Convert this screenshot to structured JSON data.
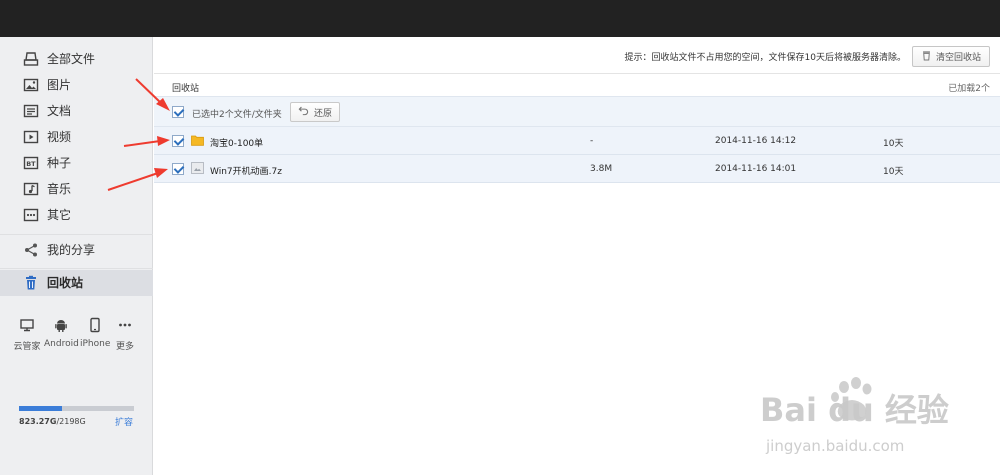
{
  "sidebar": {
    "items": [
      {
        "label": "全部文件",
        "icon": "all-files-icon"
      },
      {
        "label": "图片",
        "icon": "image-icon"
      },
      {
        "label": "文档",
        "icon": "document-icon"
      },
      {
        "label": "视频",
        "icon": "video-icon"
      },
      {
        "label": "种子",
        "icon": "torrent-icon"
      },
      {
        "label": "音乐",
        "icon": "music-icon"
      },
      {
        "label": "其它",
        "icon": "more-icon"
      }
    ],
    "share": {
      "label": "我的分享",
      "icon": "share-icon"
    },
    "recycle": {
      "label": "回收站",
      "icon": "trash-icon"
    },
    "devices": [
      {
        "label": "云管家",
        "icon": "monitor-icon"
      },
      {
        "label": "Android",
        "icon": "android-icon"
      },
      {
        "label": "iPhone",
        "icon": "phone-icon"
      },
      {
        "label": "更多",
        "icon": "ellipsis-icon"
      }
    ],
    "quota": {
      "used": "823.27G",
      "total": "/2198G",
      "fraction": 0.375,
      "expand": "扩容"
    }
  },
  "main": {
    "tip": "提示：回收站文件不占用您的空间，文件保存10天后将被服务器清除。",
    "clear_button": "清空回收站",
    "breadcrumb": "回收站",
    "loaded": "已加载2个",
    "selection": {
      "label": "已选中2个文件/文件夹",
      "restore_button": "还原"
    },
    "rows": [
      {
        "name": "淘宝0-100单",
        "type": "folder",
        "size": "-",
        "date": "2014-11-16 14:12",
        "remaining": "10天"
      },
      {
        "name": "Win7开机动画.7z",
        "type": "archive",
        "size": "3.8M",
        "date": "2014-11-16 14:01",
        "remaining": "10天"
      }
    ]
  },
  "watermark": {
    "text": "Bai du 经验",
    "url": "jingyan.baidu.com"
  },
  "colors": {
    "accent": "#3b7dd8",
    "arrow": "#ee3b2f",
    "topbar": "#222222",
    "sidebar": "#eeeff1",
    "selected_row": "#eef3fa"
  }
}
